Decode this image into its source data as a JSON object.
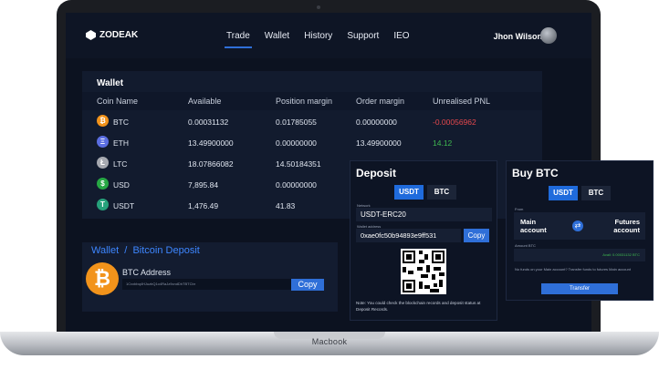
{
  "brand": {
    "name": "ZODEAK"
  },
  "nav": {
    "items": [
      {
        "label": "Trade"
      },
      {
        "label": "Wallet"
      },
      {
        "label": "History"
      },
      {
        "label": "Support"
      },
      {
        "label": "IEO"
      }
    ],
    "active": "Trade",
    "user_name": "Jhon Wilson"
  },
  "wallet": {
    "title": "Wallet",
    "columns": [
      "Coin Name",
      "Available",
      "Position margin",
      "Order margin",
      "Unrealised PNL"
    ],
    "rows": [
      {
        "coin": "BTC",
        "available": "0.00031132",
        "position_margin": "0.01785055",
        "order_margin": "0.00000000",
        "pnl": "-0.00056962",
        "pnl_color": "#e5484d",
        "icon_color": "#f2931b",
        "icon": "₿"
      },
      {
        "coin": "ETH",
        "available": "13.49900000",
        "position_margin": "0.00000000",
        "order_margin": "13.49900000",
        "pnl": "14.12",
        "pnl_color": "#3fb950",
        "icon_color": "#5b6ee1",
        "icon": "Ξ"
      },
      {
        "coin": "LTC",
        "available": "18.07866082",
        "position_margin": "14.50184351",
        "order_margin": "",
        "pnl": "",
        "pnl_color": "#dfe5ef",
        "icon_color": "#a6a9b0",
        "icon": "Ł"
      },
      {
        "coin": "USD",
        "available": "7,895.84",
        "position_margin": "0.00000000",
        "order_margin": "",
        "pnl": "",
        "pnl_color": "#dfe5ef",
        "icon_color": "#27a844",
        "icon": "$"
      },
      {
        "coin": "USDT",
        "available": "1,476.49",
        "position_margin": "41.83",
        "order_margin": "",
        "pnl": "",
        "pnl_color": "#dfe5ef",
        "icon_color": "#26a17b",
        "icon": "T"
      }
    ]
  },
  "bitcoin_deposit": {
    "breadcrumb_wallet": "Wallet",
    "breadcrumb_sep": "/",
    "breadcrumb_page": "Bitcoin Deposit",
    "address_label": "BTC Address",
    "address_value": "1Cvxbbq4HJuzbQ1o4RaJz9cndDhTBTCbr",
    "copy_label": "Copy"
  },
  "deposit": {
    "title": "Deposit",
    "tabs": [
      "USDT",
      "BTC"
    ],
    "network_label": "Network",
    "network_value": "USDT-ERC20",
    "address_label": "Wallet address",
    "address_value": "0xae0fc50b94893e9ff531",
    "copy_label": "Copy",
    "note": "Note: You could check the blockchain records and deposit status at Deposit Records."
  },
  "buy_btc": {
    "title": "Buy BTC",
    "tabs": [
      "USDT",
      "BTC"
    ],
    "from_label": "From",
    "from_account": "Main account",
    "to_account": "Futures account",
    "amount_label": "Amount BTC",
    "amount_value": "Avail: 0.00031132 BTC",
    "check_text": "No funds on your Main account? Transfer funds to futures Main account",
    "transfer_label": "Transfer"
  },
  "device": {
    "label": "Macbook"
  }
}
